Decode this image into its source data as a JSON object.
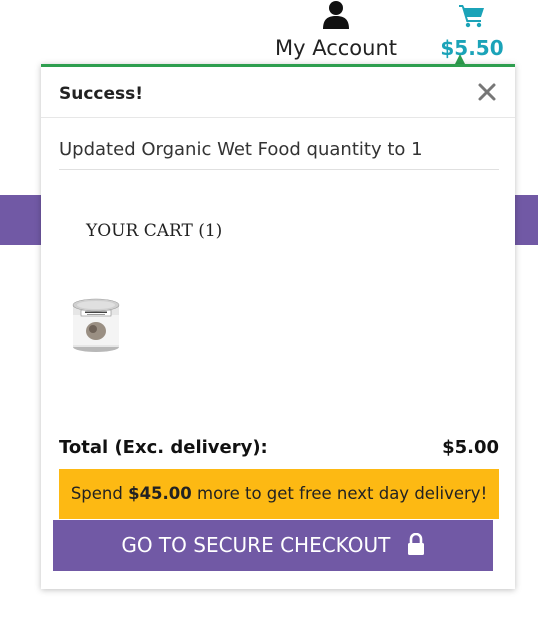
{
  "header": {
    "account_label": "My Account",
    "account_icon": "user-icon",
    "cart_icon": "cart-icon",
    "cart_amount": "$5.50"
  },
  "popup": {
    "title": "Success!",
    "close_icon": "close-icon",
    "message": "Updated Organic Wet Food quantity to 1",
    "cart_heading": "YOUR CART (1)",
    "product_image": "wet-food-can",
    "total_label": "Total (Exc. delivery):",
    "total_value": "$5.00",
    "delivery_prefix": "Spend ",
    "delivery_amount": "$45.00",
    "delivery_suffix": " more to get free next day delivery!",
    "checkout_label": "GO TO SECURE CHECKOUT",
    "lock_icon": "lock-icon"
  },
  "colors": {
    "accent_purple": "#7159a5",
    "success_green": "#2e9e4f",
    "cart_teal": "#1ba3b8",
    "delivery_yellow": "#fdb913"
  }
}
